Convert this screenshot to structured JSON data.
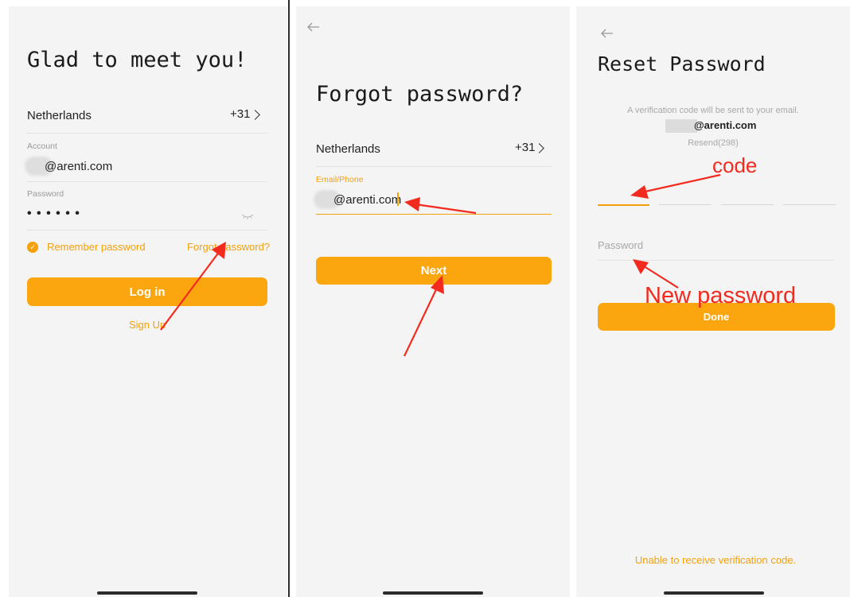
{
  "screen1": {
    "title": "Glad to meet you!",
    "country": "Netherlands",
    "country_code": "+31",
    "account_label": "Account",
    "account_value": "@arenti.com",
    "password_label": "Password",
    "password_value": "• • • • • •",
    "remember_label": "Remember password",
    "forgot_link": "Forgot password?",
    "login_button": "Log in",
    "signup_link": "Sign Up"
  },
  "screen2": {
    "title": "Forgot password?",
    "country": "Netherlands",
    "country_code": "+31",
    "field_label": "Email/Phone",
    "field_value": "@arenti.com",
    "next_button": "Next"
  },
  "screen3": {
    "title": "Reset Password",
    "info_text": "A verification code will be sent to your email.",
    "email": "@arenti.com",
    "resend": "Resend(298)",
    "password_placeholder": "Password",
    "done_button": "Done",
    "unable_link": "Unable to receive verification code."
  },
  "annotations": {
    "code": "code",
    "new_password": "New password"
  },
  "colors": {
    "accent": "#fba60f",
    "annotation": "#f32b1e",
    "background": "#f4f4f4"
  }
}
